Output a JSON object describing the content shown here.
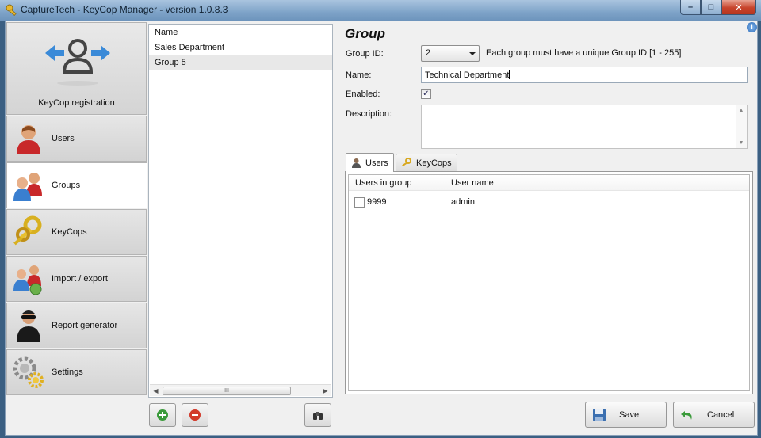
{
  "window": {
    "title": "CaptureTech - KeyCop Manager - version 1.0.8.3",
    "controls": {
      "minimize": "–",
      "maximize": "□",
      "close": "✕"
    }
  },
  "nav": {
    "registration_label": "KeyCop registration",
    "items": [
      {
        "label": "Users",
        "icon": "user-icon"
      },
      {
        "label": "Groups",
        "icon": "groups-icon",
        "active": true
      },
      {
        "label": "KeyCops",
        "icon": "keys-icon"
      },
      {
        "label": "Import / export",
        "icon": "import-export-icon"
      },
      {
        "label": "Report generator",
        "icon": "report-icon"
      },
      {
        "label": "Settings",
        "icon": "gears-icon"
      }
    ]
  },
  "group_list": {
    "header": "Name",
    "rows": [
      "Sales Department",
      "Group 5"
    ],
    "selected_index": 1,
    "scroll_thumb_glyph": "III"
  },
  "details": {
    "title": "Group",
    "group_id_label": "Group ID:",
    "group_id_value": "2",
    "group_id_hint": "Each group must have a unique Group ID [1 - 255]",
    "name_label": "Name:",
    "name_value": "Technical Department",
    "enabled_label": "Enabled:",
    "enabled_checked": true,
    "description_label": "Description:",
    "description_value": "",
    "info_glyph": "i"
  },
  "tabs": [
    {
      "label": "Users",
      "active": true,
      "icon": "user-icon"
    },
    {
      "label": "KeyCops",
      "active": false,
      "icon": "keys-icon"
    }
  ],
  "members_grid": {
    "columns": [
      "Users in group",
      "User name"
    ],
    "rows": [
      {
        "id": "9999",
        "name": "admin",
        "checked": false
      }
    ]
  },
  "buttons": {
    "save": "Save",
    "cancel": "Cancel"
  },
  "colors": {
    "add_green": "#3a9a3a",
    "remove_red": "#d23a2a",
    "titlebar": "#7ea3c8"
  }
}
